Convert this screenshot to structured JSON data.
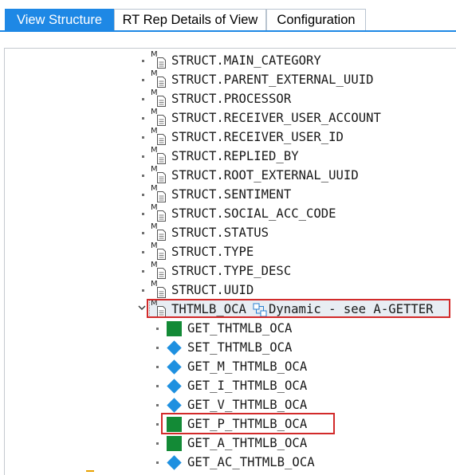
{
  "tabs": [
    {
      "label": "View Structure",
      "active": true
    },
    {
      "label": "RT Rep Details of View",
      "active": false
    },
    {
      "label": "Configuration",
      "active": false
    }
  ],
  "tree": {
    "struct_items": [
      {
        "marker": "M",
        "label": "STRUCT.MAIN_CATEGORY"
      },
      {
        "marker": "M",
        "label": "STRUCT.PARENT_EXTERNAL_UUID"
      },
      {
        "marker": "M",
        "label": "STRUCT.PROCESSOR"
      },
      {
        "marker": "M",
        "label": "STRUCT.RECEIVER_USER_ACCOUNT"
      },
      {
        "marker": "M",
        "label": "STRUCT.RECEIVER_USER_ID"
      },
      {
        "marker": "M",
        "label": "STRUCT.REPLIED_BY"
      },
      {
        "marker": "M",
        "label": "STRUCT.ROOT_EXTERNAL_UUID"
      },
      {
        "marker": "M",
        "label": "STRUCT.SENTIMENT"
      },
      {
        "marker": "M",
        "label": "STRUCT.SOCIAL_ACC_CODE"
      },
      {
        "marker": "M",
        "label": "STRUCT.STATUS"
      },
      {
        "marker": "M",
        "label": "STRUCT.TYPE"
      },
      {
        "marker": "M",
        "label": "STRUCT.TYPE_DESC"
      },
      {
        "marker": "M",
        "label": "STRUCT.UUID"
      }
    ],
    "expanded_node": {
      "marker": "M",
      "label": "THTMLB_OCA",
      "description": "Dynamic - see A-GETTER",
      "expanded": true,
      "selected": true
    },
    "methods": [
      {
        "label": "GET_THTMLB_OCA",
        "icon": "green-square-icon"
      },
      {
        "label": "SET_THTMLB_OCA",
        "icon": "blue-diamond-icon"
      },
      {
        "label": "GET_M_THTMLB_OCA",
        "icon": "blue-diamond-icon"
      },
      {
        "label": "GET_I_THTMLB_OCA",
        "icon": "blue-diamond-icon"
      },
      {
        "label": "GET_V_THTMLB_OCA",
        "icon": "blue-diamond-icon"
      },
      {
        "label": "GET_P_THTMLB_OCA",
        "icon": "green-square-icon",
        "highlighted": true
      },
      {
        "label": "GET_A_THTMLB_OCA",
        "icon": "green-square-icon"
      },
      {
        "label": "GET_AC_THTMLB_OCA",
        "icon": "blue-diamond-icon"
      }
    ]
  },
  "colors": {
    "accent": "#1e88e5",
    "highlight_border": "#d22a2a",
    "implemented_method": "#138a36",
    "unimplemented_method": "#1e90e0"
  }
}
